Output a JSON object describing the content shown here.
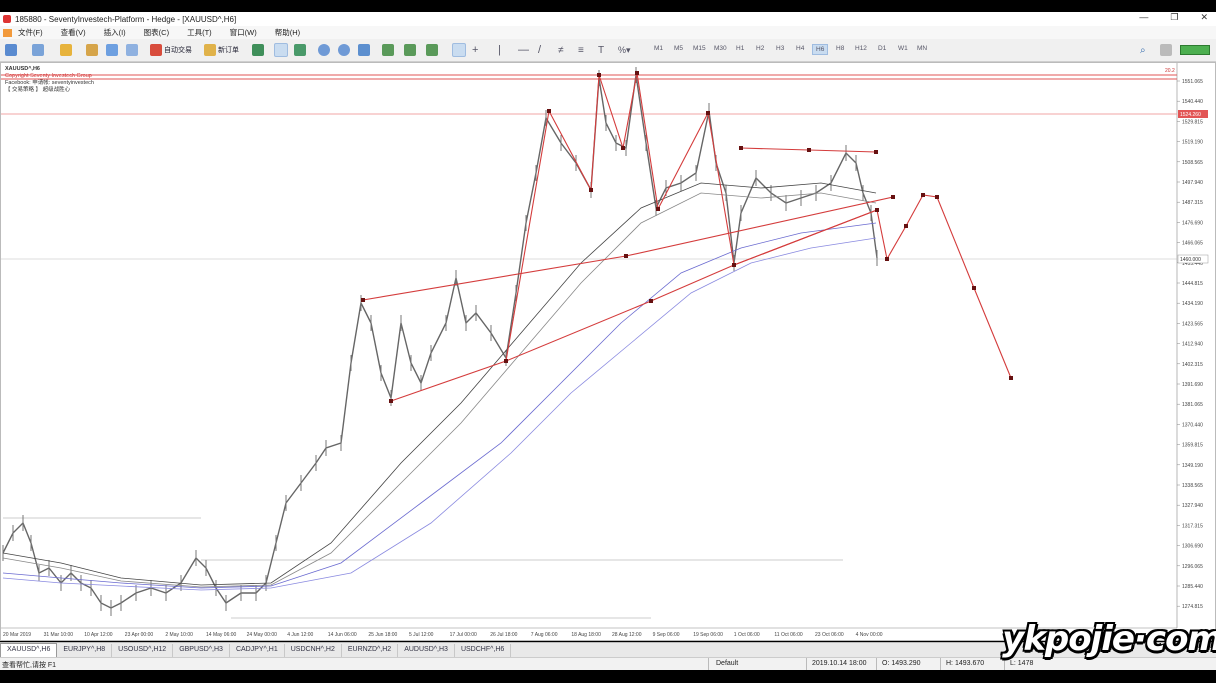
{
  "window": {
    "title": "185880 - SeventyInvestech-Platform - Hedge - [XAUUSD^,H6]",
    "controls": [
      "—",
      "❐",
      "✕"
    ]
  },
  "menu": [
    "文件(F)",
    "查看(V)",
    "插入(I)",
    "图表(C)",
    "工具(T)",
    "窗口(W)",
    "帮助(H)"
  ],
  "toolbar": {
    "autotrade_label": "自动交易",
    "neworder_label": "新订单",
    "timeframes": [
      "M1",
      "M5",
      "M15",
      "M30",
      "H1",
      "H2",
      "H3",
      "H4",
      "H6",
      "H8",
      "H12",
      "D1",
      "W1",
      "MN"
    ],
    "active_timeframe": "H6"
  },
  "chart": {
    "symbol_label": "XAUUSD^,H6",
    "header_lines": [
      "Copyright Seventy Investech Group",
      "Facebook: 申请帐: seventyinvestech",
      "【 交易策略 】 超级战胜心"
    ],
    "price_labels": [
      "1551.065",
      "1540.440",
      "1529.815",
      "1519.190",
      "1508.565",
      "1497.940",
      "1487.315",
      "1476.690",
      "1466.065",
      "1455.440",
      "1444.815",
      "1434.190",
      "1423.565",
      "1412.940",
      "1402.315",
      "1391.690",
      "1381.065",
      "1370.440",
      "1359.815",
      "1349.190",
      "1338.565",
      "1327.940",
      "1317.315",
      "1306.690",
      "1296.065",
      "1285.440",
      "1274.815"
    ],
    "current_price_tag": "1524.260",
    "bid_tag": "1460.000",
    "top_right_tag": "20.2",
    "time_labels": [
      "20 Mar 2019",
      "31 Mar 10:00",
      "10 Apr 12:00",
      "23 Apr 00:00",
      "2 May 10:00",
      "14 May 06:00",
      "24 May 00:00",
      "4 Jun 12:00",
      "14 Jun 06:00",
      "25 Jun 18:00",
      "5 Jul 12:00",
      "17 Jul 00:00",
      "26 Jul 18:00",
      "7 Aug 06:00",
      "18 Aug 18:00",
      "28 Aug 12:00",
      "9 Sep 06:00",
      "19 Sep 06:00",
      "1 Oct 06:00",
      "11 Oct 06:00",
      "23 Oct 06:00",
      "4 Nov 00:00"
    ]
  },
  "tabs": [
    "XAUUSD^,H6",
    "EURJPY^,H8",
    "USOUSD^,H12",
    "GBPUSD^,H3",
    "CADJPY^,H1",
    "USDCNH^,H2",
    "EURNZD^,H2",
    "AUDUSD^,H3",
    "USDCHF^,H6"
  ],
  "active_tab": "XAUUSD^,H6",
  "status": {
    "help": "查看帮忙,请按 F1",
    "profile": "Default",
    "datetime": "2019.10.14 18:00",
    "open": "O: 1493.290",
    "high": "H: 1493.670",
    "low": "L: 1478"
  },
  "watermark": "ykpojie·com"
}
